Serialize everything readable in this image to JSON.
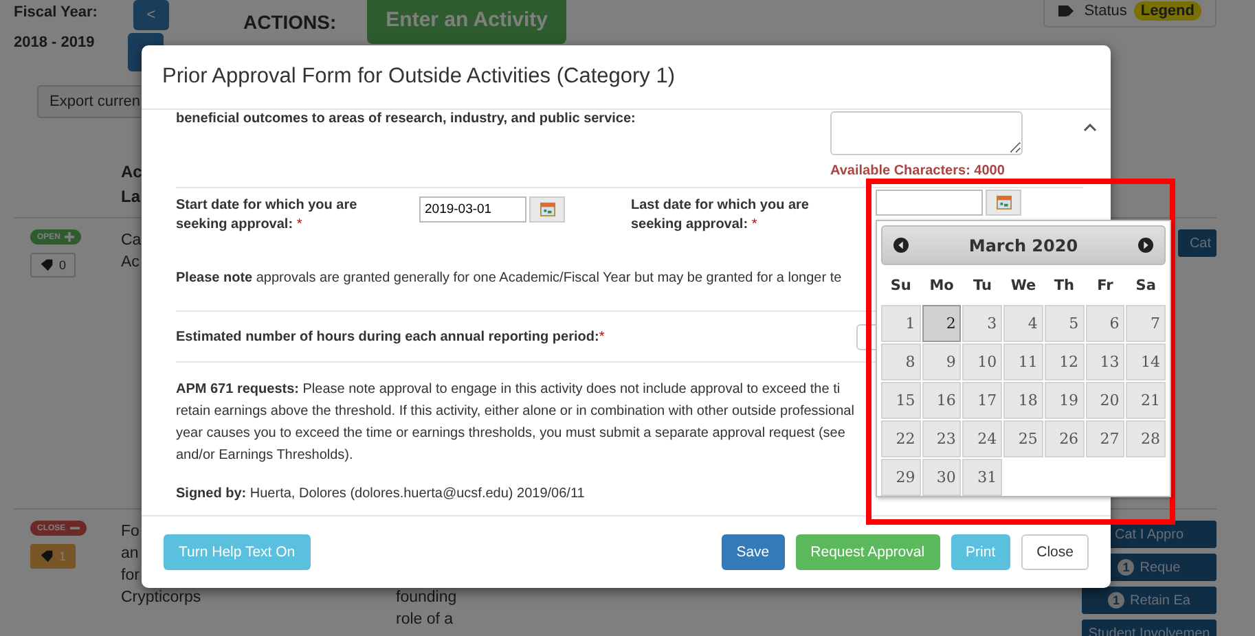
{
  "page": {
    "fiscal_year_label": "Fiscal Year:",
    "fiscal_year": "2018 - 2019",
    "prev_button": "<",
    "actions_label": "ACTIONS:",
    "enter_activity_button": "Enter an Activity",
    "status_legend": {
      "label": "Status",
      "badge": "Legend"
    },
    "export_button": "Export curren",
    "column_headers": [
      "Ac",
      "La"
    ],
    "rows": [
      {
        "status_badge": {
          "label": "OPEN",
          "kind": "open"
        },
        "tag_badge": {
          "count": "0",
          "kind": "plain"
        },
        "text_lines": [
          "Ca",
          "Ac"
        ],
        "column_2_lines": [],
        "right_buttons": [
          {
            "label": "Cat"
          }
        ]
      },
      {
        "status_badge": {
          "label": "CLOSE",
          "kind": "close"
        },
        "tag_badge": {
          "count": "1",
          "kind": "warning"
        },
        "text_lines": [
          "Fo",
          "an",
          "for",
          "Crypticorps"
        ],
        "column_2_lines": [
          "founding",
          "role of a"
        ],
        "right_buttons": [
          {
            "label": "Cat I Appro"
          },
          {
            "count": "1",
            "label": "Reque"
          },
          {
            "count": "1",
            "label": "Retain Ea"
          },
          {
            "label": "Student Involvemen"
          }
        ]
      }
    ]
  },
  "modal": {
    "title": "Prior Approval Form for Outside Activities (Category 1)",
    "outcomes_label": "beneficial outcomes to areas of research, industry, and public service:",
    "available_characters": "Available Characters: 4000",
    "start_date": {
      "label": "Start date for which you are seeking approval:",
      "required_mark": "*",
      "value": "2019-03-01"
    },
    "last_date": {
      "label": "Last date for which you are seeking approval:",
      "required_mark": "*"
    },
    "note": "**Please note** approvals are granted generally for one Academic/Fiscal Year but may be granted for a longer te",
    "hours": {
      "label": "Estimated number of hours during each annual reporting period:",
      "required_mark": "*"
    },
    "apm_notice": "**APM 671 requests:** Please note approval to engage in this activity does not include approval to exceed the ti\nretain earnings above the threshold. If this activity, either alone or in combination with other outside professional\nyear causes you to exceed the time or earnings thresholds, you must submit a separate approval request (see\nand/or Earnings Thresholds).",
    "signed_by": "**Signed by:** Huerta, Dolores (dolores.huerta@ucsf.edu) 2019/06/11",
    "help_button": "Turn Help Text On",
    "buttons": [
      {
        "label": "Save",
        "kind": "primary"
      },
      {
        "label": "Request Approval",
        "kind": "success"
      },
      {
        "label": "Print",
        "kind": "info"
      },
      {
        "label": "Close",
        "kind": "default"
      }
    ]
  },
  "datepicker": {
    "month": "March 2020",
    "weekdays": [
      "Su",
      "Mo",
      "Tu",
      "We",
      "Th",
      "Fr",
      "Sa"
    ],
    "weeks": [
      [
        {
          "day": "1",
          "selected": false
        },
        {
          "day": "2",
          "selected": true
        },
        {
          "day": "3",
          "selected": false
        },
        {
          "day": "4",
          "selected": false
        },
        {
          "day": "5",
          "selected": false
        },
        {
          "day": "6",
          "selected": false
        },
        {
          "day": "7",
          "selected": false
        }
      ],
      [
        {
          "day": "8",
          "selected": false
        },
        {
          "day": "9",
          "selected": false
        },
        {
          "day": "10",
          "selected": false
        },
        {
          "day": "11",
          "selected": false
        },
        {
          "day": "12",
          "selected": false
        },
        {
          "day": "13",
          "selected": false
        },
        {
          "day": "14",
          "selected": false
        }
      ],
      [
        {
          "day": "15",
          "selected": false
        },
        {
          "day": "16",
          "selected": false
        },
        {
          "day": "17",
          "selected": false
        },
        {
          "day": "18",
          "selected": false
        },
        {
          "day": "19",
          "selected": false
        },
        {
          "day": "20",
          "selected": false
        },
        {
          "day": "21",
          "selected": false
        }
      ],
      [
        {
          "day": "22",
          "selected": false
        },
        {
          "day": "23",
          "selected": false
        },
        {
          "day": "24",
          "selected": false
        },
        {
          "day": "25",
          "selected": false
        },
        {
          "day": "26",
          "selected": false
        },
        {
          "day": "27",
          "selected": false
        },
        {
          "day": "28",
          "selected": false
        }
      ],
      [
        {
          "day": "29",
          "selected": false
        },
        {
          "day": "30",
          "selected": false
        },
        {
          "day": "31",
          "selected": false
        }
      ]
    ]
  }
}
